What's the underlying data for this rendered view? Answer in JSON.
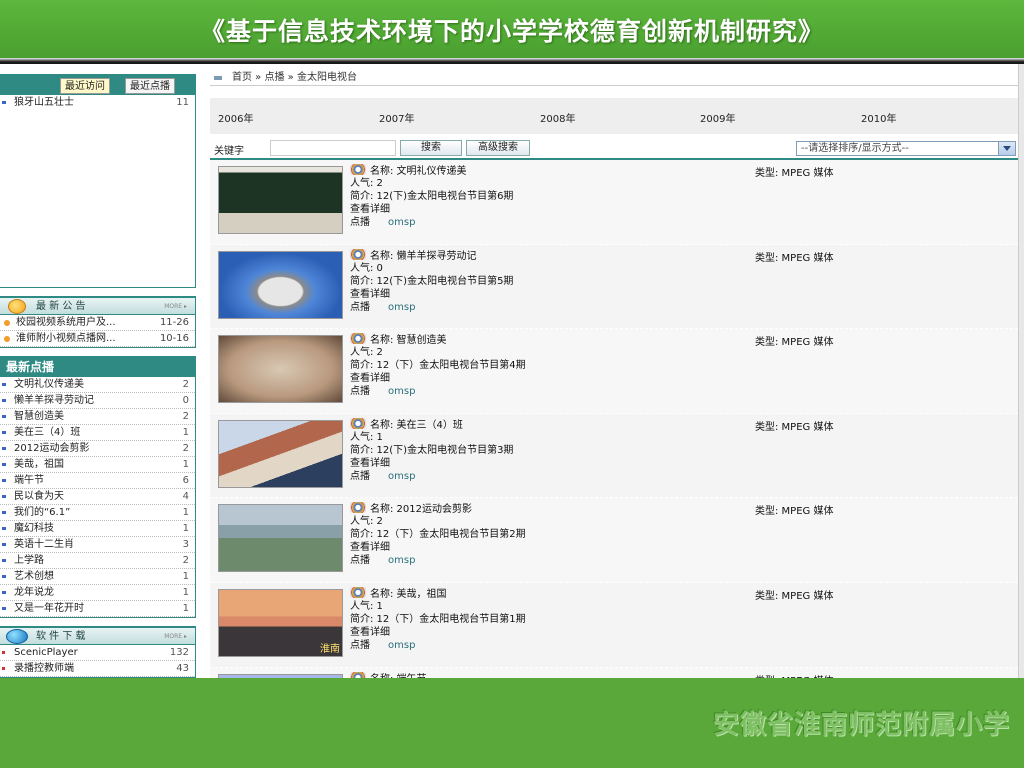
{
  "banner": {
    "title": "《基于信息技术环境下的小学学校德育创新机制研究》"
  },
  "sidebar": {
    "tabs": [
      "最近访问",
      "最近点播"
    ],
    "recent": [
      {
        "label": "狼牙山五壮士",
        "count": "11"
      }
    ],
    "announcements_title": "最 新 公 告",
    "more": "MORE ▸",
    "announcements": [
      {
        "label": "校园视频系统用户及...",
        "date": "11-26"
      },
      {
        "label": "淮师附小视频点播网...",
        "date": "10-16"
      }
    ],
    "new_title": "最新点播",
    "new_items": [
      {
        "label": "文明礼仪传递美",
        "count": "2"
      },
      {
        "label": "懒羊羊探寻劳动记",
        "count": "0"
      },
      {
        "label": "智慧创造美",
        "count": "2"
      },
      {
        "label": "美在三（4）班",
        "count": "1"
      },
      {
        "label": "2012运动会剪影",
        "count": "2"
      },
      {
        "label": "美哉，祖国",
        "count": "1"
      },
      {
        "label": "端午节",
        "count": "6"
      },
      {
        "label": "民以食为天",
        "count": "4"
      },
      {
        "label": "我们的“6.1”",
        "count": "1"
      },
      {
        "label": "魔幻科技",
        "count": "1"
      },
      {
        "label": "英语十二生肖",
        "count": "3"
      },
      {
        "label": "上学路",
        "count": "2"
      },
      {
        "label": "艺术创想",
        "count": "1"
      },
      {
        "label": "龙年说龙",
        "count": "1"
      },
      {
        "label": "又是一年花开时",
        "count": "1"
      }
    ],
    "download_title": "软 件 下 载",
    "downloads": [
      {
        "label": "ScenicPlayer",
        "count": "132"
      },
      {
        "label": "录播控教师端",
        "count": "43"
      }
    ]
  },
  "main": {
    "breadcrumb": "首页 » 点播 » 金太阳电视台",
    "years": [
      "2006年",
      "2007年",
      "2008年",
      "2009年",
      "2010年"
    ],
    "search": {
      "label": "关键字",
      "value": "",
      "search_btn": "搜索",
      "advanced_btn": "高级搜索",
      "sort_select": "--请选择排序/显示方式--"
    },
    "items": [
      {
        "name": "名称: 文明礼仪传递美",
        "popularity": "人气: 2",
        "intro": "简介: 12(下)金太阳电视台节目第6期",
        "detail": "查看详细",
        "play": "点播",
        "omsp": "omsp",
        "type": "类型: MPEG 媒体"
      },
      {
        "name": "名称: 懒羊羊探寻劳动记",
        "popularity": "人气: 0",
        "intro": "简介: 12(下)金太阳电视台节目第5期",
        "detail": "查看详细",
        "play": "点播",
        "omsp": "omsp",
        "type": "类型: MPEG 媒体"
      },
      {
        "name": "名称: 智慧创造美",
        "popularity": "人气: 2",
        "intro": "简介: 12（下）金太阳电视台节目第4期",
        "detail": "查看详细",
        "play": "点播",
        "omsp": "omsp",
        "type": "类型: MPEG 媒体"
      },
      {
        "name": "名称: 美在三（4）班",
        "popularity": "人气: 1",
        "intro": "简介: 12(下)金太阳电视台节目第3期",
        "detail": "查看详细",
        "play": "点播",
        "omsp": "omsp",
        "type": "类型: MPEG 媒体"
      },
      {
        "name": "名称: 2012运动会剪影",
        "popularity": "人气: 2",
        "intro": "简介: 12（下）金太阳电视台节目第2期",
        "detail": "查看详细",
        "play": "点播",
        "omsp": "omsp",
        "type": "类型: MPEG 媒体"
      },
      {
        "name": "名称: 美哉，祖国",
        "popularity": "人气: 1",
        "intro": "简介: 12（下）金太阳电视台节目第1期",
        "detail": "查看详细",
        "play": "点播",
        "omsp": "omsp",
        "type": "类型: MPEG 媒体",
        "watermark": "淮南"
      },
      {
        "name": "名称: 端午节",
        "popularity": "人气: 6",
        "intro": "",
        "detail": "",
        "play": "",
        "omsp": "",
        "type": "类型: MPEG 媒体"
      }
    ]
  },
  "footer": {
    "school": "安徽省淮南师范附属小学"
  }
}
